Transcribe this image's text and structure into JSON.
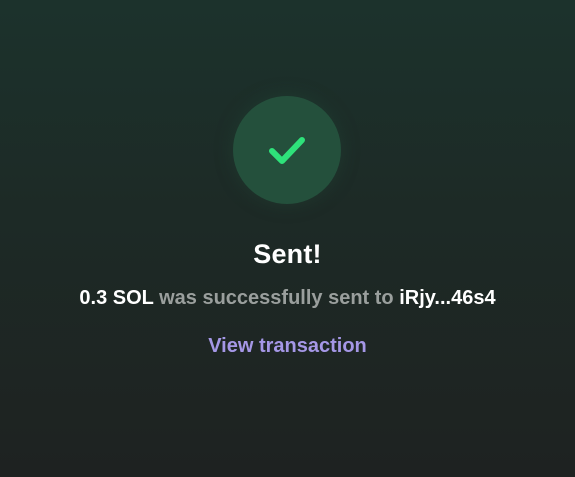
{
  "status": {
    "icon": "checkmark-icon",
    "accent_color": "#2ee27a",
    "circle_color": "#24503c"
  },
  "title": "Sent!",
  "message": {
    "amount": "0.3 SOL",
    "text": " was successfully sent to ",
    "recipient": "iRjy...46s4"
  },
  "link": {
    "label": "View transaction",
    "color": "#a597e6"
  }
}
